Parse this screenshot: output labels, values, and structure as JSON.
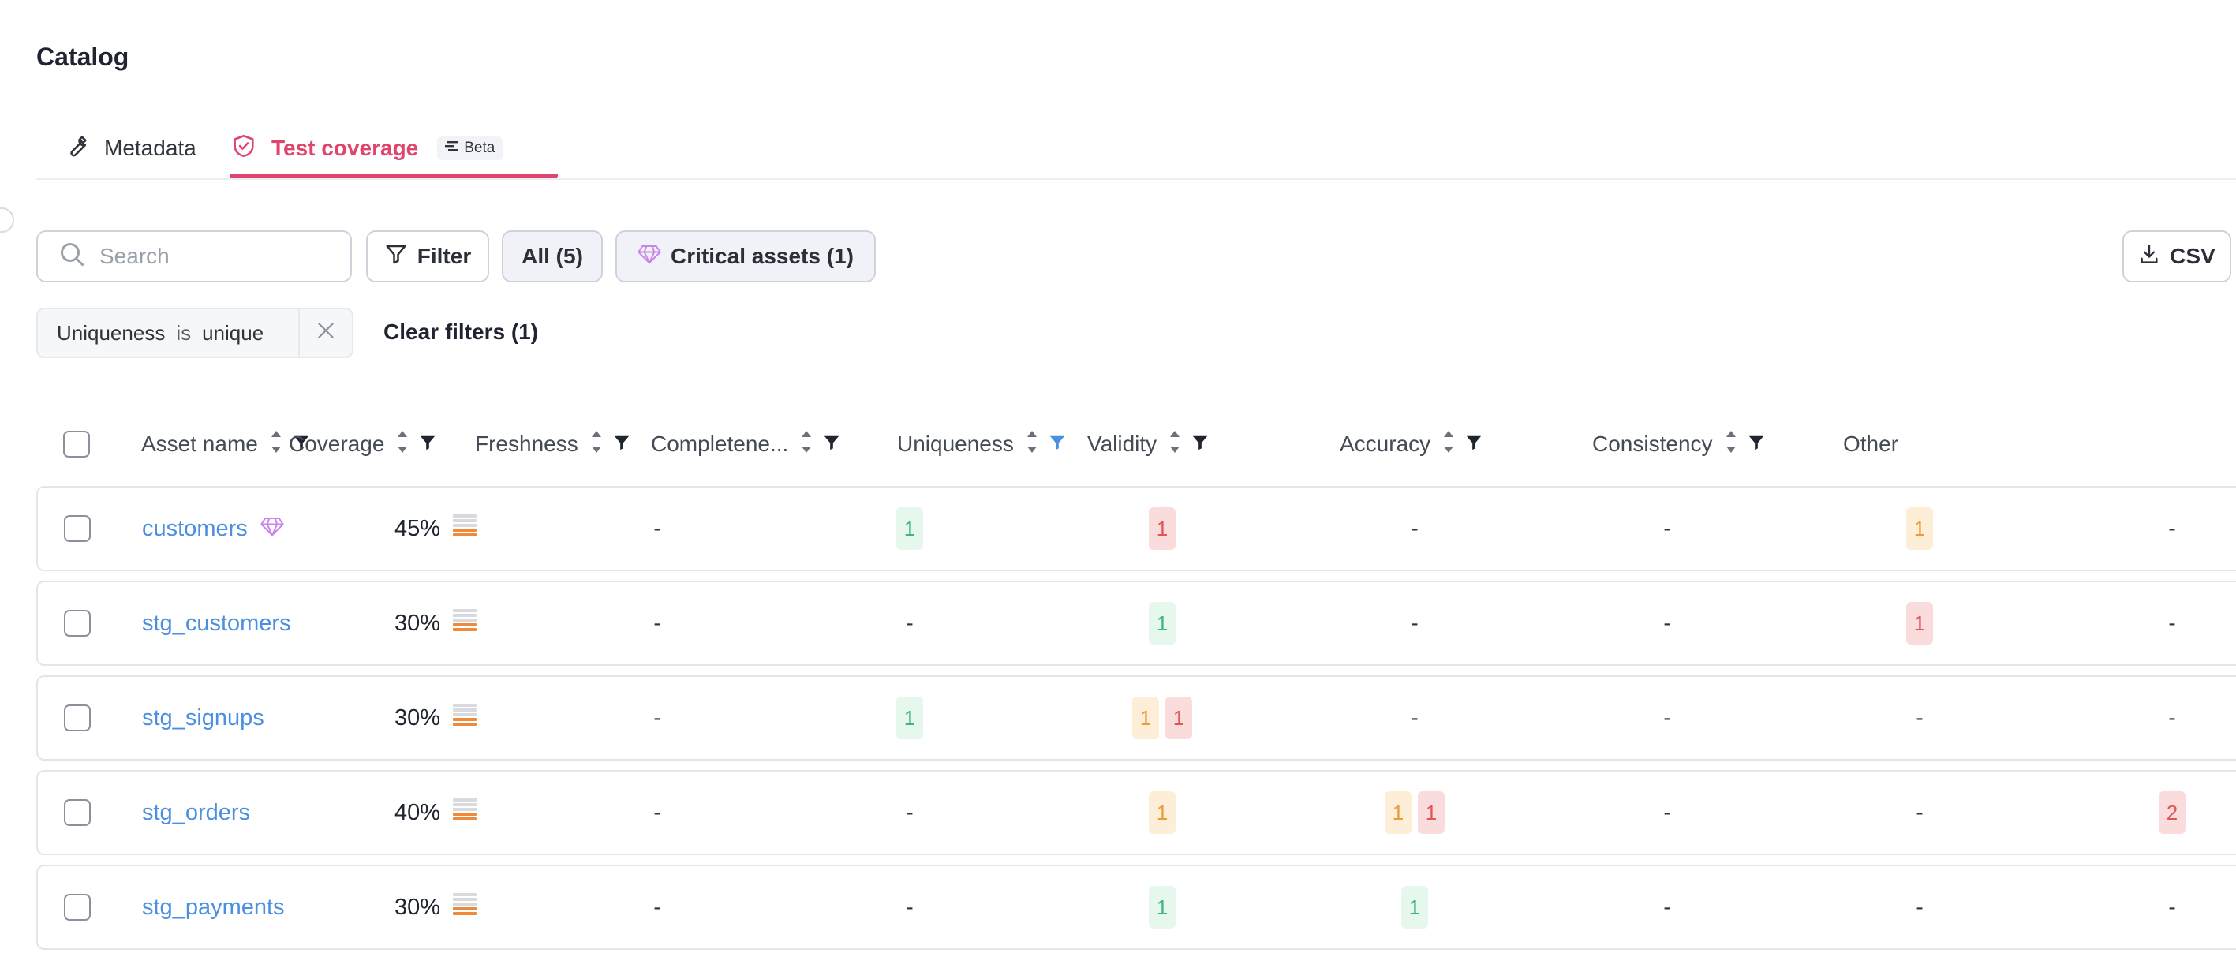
{
  "page": {
    "title": "Catalog"
  },
  "tabs": [
    {
      "label": "Metadata",
      "icon": "wrench-icon",
      "active": false
    },
    {
      "label": "Test coverage",
      "icon": "shield-check-icon",
      "active": true,
      "badge": "Beta"
    }
  ],
  "toolbar": {
    "search_placeholder": "Search",
    "filter_label": "Filter",
    "all_label": "All (5)",
    "critical_label": "Critical assets (1)",
    "csv_label": "CSV"
  },
  "active_filter": {
    "field": "Uniqueness",
    "operator": "is",
    "value": "unique"
  },
  "clear_filters_label": "Clear filters (1)",
  "columns": [
    "Asset name",
    "Coverage",
    "Freshness",
    "Completene...",
    "Uniqueness",
    "Validity",
    "Accuracy",
    "Consistency",
    "Other"
  ],
  "colors": {
    "accent": "#e0456e",
    "link": "#4a8fe0",
    "green": "#3fb47c",
    "red": "#e05656",
    "orange": "#ee9a3a",
    "filter_active": "#4a8fe0"
  },
  "rows": [
    {
      "name": "customers",
      "critical": true,
      "coverage": "45%",
      "freshness": "-",
      "completeness": [
        {
          "v": "1",
          "c": "green"
        }
      ],
      "uniqueness": [
        {
          "v": "1",
          "c": "red"
        }
      ],
      "validity": "-",
      "accuracy": "-",
      "consistency": [
        {
          "v": "1",
          "c": "orange"
        }
      ],
      "other": "-"
    },
    {
      "name": "stg_customers",
      "critical": false,
      "coverage": "30%",
      "freshness": "-",
      "completeness": "-",
      "uniqueness": [
        {
          "v": "1",
          "c": "green"
        }
      ],
      "validity": "-",
      "accuracy": "-",
      "consistency": [
        {
          "v": "1",
          "c": "red"
        }
      ],
      "other": "-"
    },
    {
      "name": "stg_signups",
      "critical": false,
      "coverage": "30%",
      "freshness": "-",
      "completeness": [
        {
          "v": "1",
          "c": "green"
        }
      ],
      "uniqueness": [
        {
          "v": "1",
          "c": "orange"
        },
        {
          "v": "1",
          "c": "red"
        }
      ],
      "validity": "-",
      "accuracy": "-",
      "consistency": "-",
      "other": "-"
    },
    {
      "name": "stg_orders",
      "critical": false,
      "coverage": "40%",
      "freshness": "-",
      "completeness": "-",
      "uniqueness": [
        {
          "v": "1",
          "c": "orange"
        }
      ],
      "validity": [
        {
          "v": "1",
          "c": "orange"
        },
        {
          "v": "1",
          "c": "red"
        }
      ],
      "accuracy": "-",
      "consistency": "-",
      "other": [
        {
          "v": "2",
          "c": "red"
        }
      ]
    },
    {
      "name": "stg_payments",
      "critical": false,
      "coverage": "30%",
      "freshness": "-",
      "completeness": "-",
      "uniqueness": [
        {
          "v": "1",
          "c": "green"
        }
      ],
      "validity": [
        {
          "v": "1",
          "c": "green"
        }
      ],
      "accuracy": "-",
      "consistency": "-",
      "other": "-"
    }
  ]
}
